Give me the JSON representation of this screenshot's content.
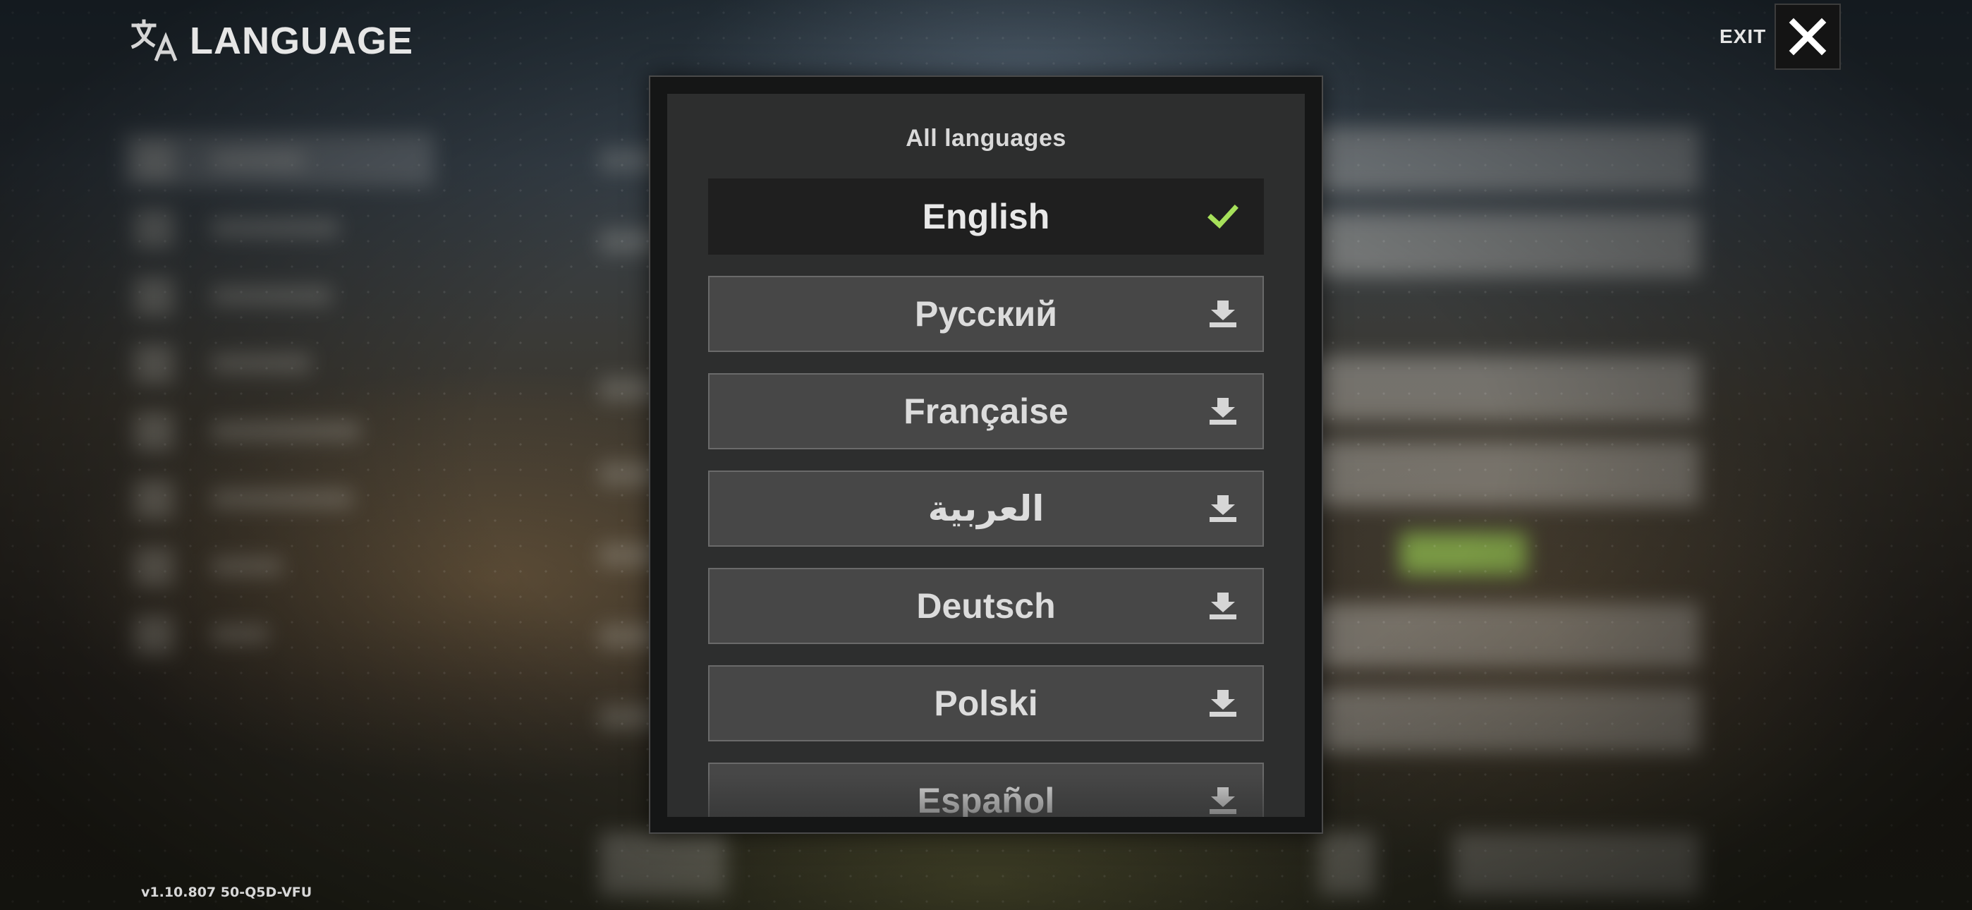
{
  "header": {
    "title": "LANGUAGE",
    "icon": "translate-icon"
  },
  "exit": {
    "label": "EXIT",
    "icon": "close-icon"
  },
  "modal": {
    "heading": "All languages",
    "languages": [
      {
        "name": "English",
        "status": "selected",
        "icon": "checkmark-icon"
      },
      {
        "name": "Русский",
        "status": "download",
        "icon": "download-icon"
      },
      {
        "name": "Française",
        "status": "download",
        "icon": "download-icon"
      },
      {
        "name": "العربية",
        "status": "download",
        "icon": "download-icon"
      },
      {
        "name": "Deutsch",
        "status": "download",
        "icon": "download-icon"
      },
      {
        "name": "Polski",
        "status": "download",
        "icon": "download-icon"
      },
      {
        "name": "Español",
        "status": "download",
        "icon": "download-icon"
      }
    ]
  },
  "version": "v1.10.807 50-Q5D-VFU",
  "colors": {
    "selected_check": "#a6e05a",
    "accent_green": "#96c850"
  }
}
